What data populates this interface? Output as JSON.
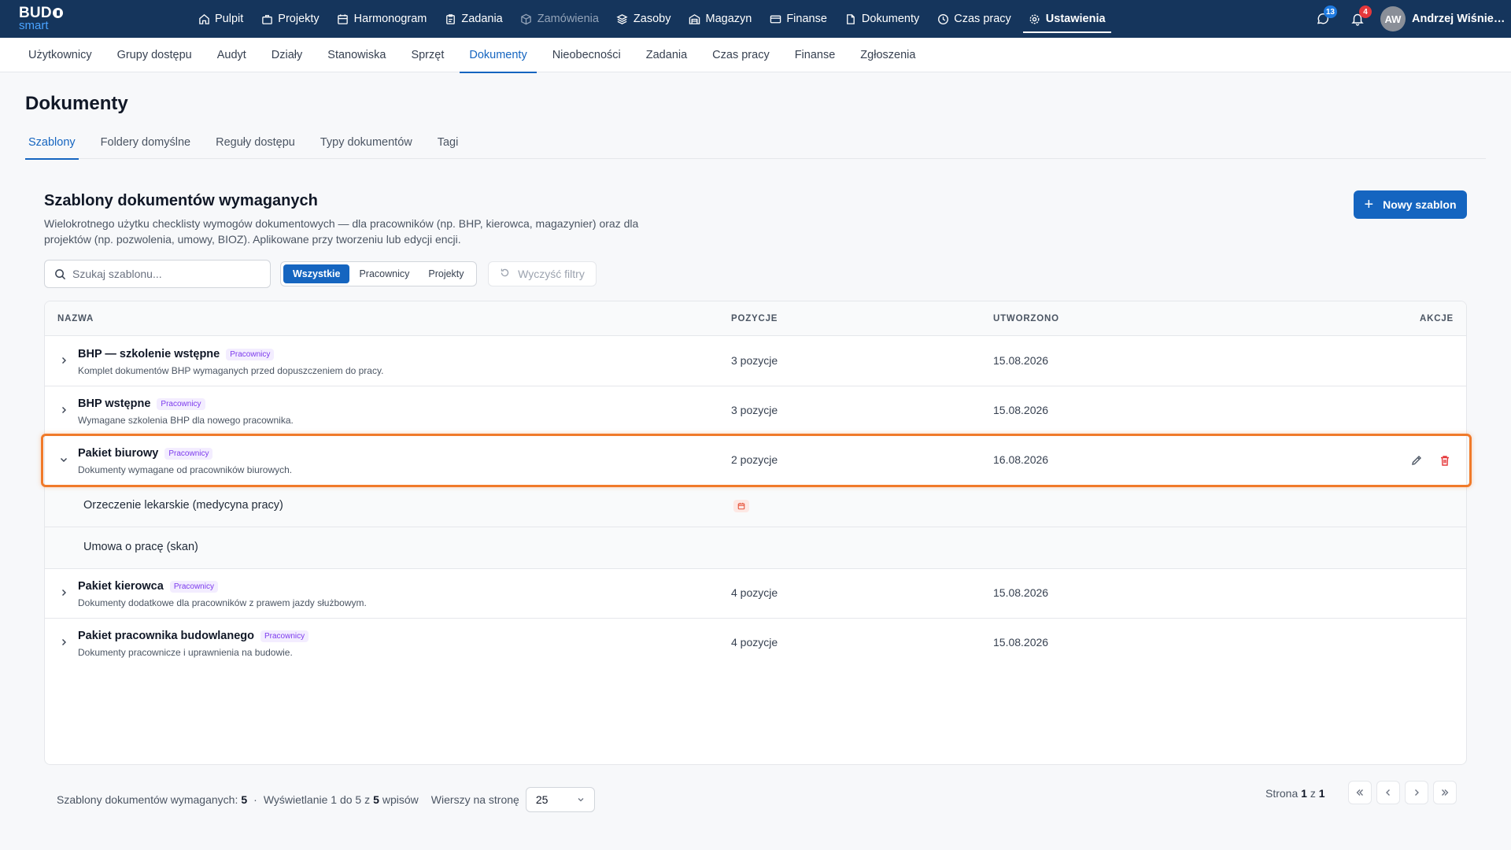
{
  "app": {
    "logo_line1": "BUD",
    "logo_line2": "smart"
  },
  "main_nav": [
    {
      "label": "Pulpit",
      "icon": "home-icon"
    },
    {
      "label": "Projekty",
      "icon": "briefcase-icon"
    },
    {
      "label": "Harmonogram",
      "icon": "calendar-icon"
    },
    {
      "label": "Zadania",
      "icon": "clipboard-icon"
    },
    {
      "label": "Zamówienia",
      "icon": "box-icon"
    },
    {
      "label": "Zasoby",
      "icon": "layers-icon"
    },
    {
      "label": "Magazyn",
      "icon": "warehouse-icon"
    },
    {
      "label": "Finanse",
      "icon": "card-icon"
    },
    {
      "label": "Dokumenty",
      "icon": "documents-icon"
    },
    {
      "label": "Czas pracy",
      "icon": "clock-icon"
    },
    {
      "label": "Ustawienia",
      "icon": "gear-icon"
    }
  ],
  "header_right": {
    "messages_count": "13",
    "notifications_count": "4",
    "avatar_initials": "AW",
    "user_name": "Andrzej Wiśniewski"
  },
  "sub_nav": [
    "Użytkownicy",
    "Grupy dostępu",
    "Audyt",
    "Działy",
    "Stanowiska",
    "Sprzęt",
    "Dokumenty",
    "Nieobecności",
    "Zadania",
    "Czas pracy",
    "Finanse",
    "Zgłoszenia"
  ],
  "page": {
    "title": "Dokumenty",
    "tabs": [
      "Szablony",
      "Foldery domyślne",
      "Reguły dostępu",
      "Typy dokumentów",
      "Tagi"
    ]
  },
  "section": {
    "title": "Szablony dokumentów wymaganych",
    "description": "Wielokrotnego użytku checklisty wymogów dokumentowych — dla pracowników (np. BHP, kierowca, magazynier) oraz dla projektów (np. pozwolenia, umowy, BIOZ). Aplikowane przy tworzeniu lub edycji encji.",
    "new_button": "Nowy szablon"
  },
  "filters": {
    "search_placeholder": "Szukaj szablonu...",
    "segments": [
      "Wszystkie",
      "Pracownicy",
      "Projekty"
    ],
    "clear_label": "Wyczyść filtry"
  },
  "table": {
    "headers": {
      "name": "NAZWA",
      "positions": "POZYCJE",
      "created": "UTWORZONO",
      "actions": "AKCJE"
    },
    "rows": [
      {
        "name": "BHP — szkolenie wstępne",
        "tag": "Pracownicy",
        "desc": "Komplet dokumentów BHP wymaganych przed dopuszczeniem do pracy.",
        "positions": "3 pozycje",
        "created": "15.08.2026"
      },
      {
        "name": "BHP wstępne",
        "tag": "Pracownicy",
        "desc": "Wymagane szkolenia BHP dla nowego pracownika.",
        "positions": "3 pozycje",
        "created": "15.08.2026"
      },
      {
        "name": "Pakiet biurowy",
        "tag": "Pracownicy",
        "desc": "Dokumenty wymagane od pracowników biurowych.",
        "positions": "2 pozycje",
        "created": "16.08.2026"
      },
      {
        "name": "Pakiet kierowca",
        "tag": "Pracownicy",
        "desc": "Dokumenty dodatkowe dla pracowników z prawem jazdy służbowym.",
        "positions": "4 pozycje",
        "created": "15.08.2026"
      },
      {
        "name": "Pakiet pracownika budowlanego",
        "tag": "Pracownicy",
        "desc": "Dokumenty pracownicze i uprawnienia na budowie.",
        "positions": "4 pozycje",
        "created": "15.08.2026"
      }
    ],
    "expanded_items": [
      {
        "name": "Orzeczenie lekarskie (medycyna pracy)"
      },
      {
        "name": "Umowa o pracę (skan)"
      }
    ]
  },
  "footer": {
    "count_label": "Szablony dokumentów wymaganych:",
    "count": "5",
    "showing_prefix": "Wyświetlanie 1 do 5 z",
    "showing_total": "5",
    "showing_suffix": "wpisów",
    "rows_per_page_label": "Wierszy na stronę",
    "rows_per_page": "25",
    "page_label": "Strona",
    "page_current": "1",
    "page_of": "z",
    "page_total": "1"
  },
  "colors": {
    "nav_bg": "#15355c",
    "accent": "#1565c0",
    "highlight": "#f07a2a",
    "tag_purple": "#7c3aed",
    "danger": "#e5383b"
  }
}
